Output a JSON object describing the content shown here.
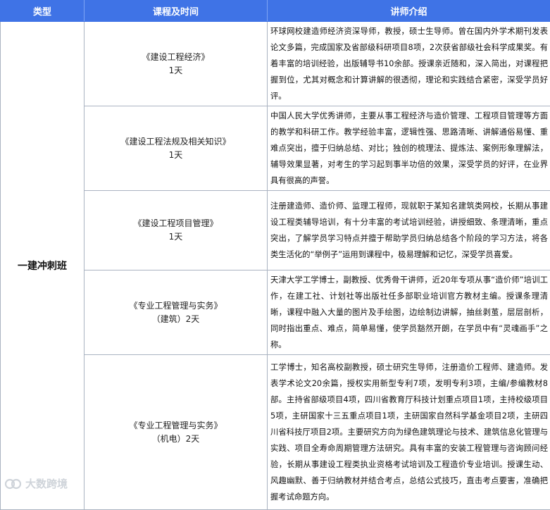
{
  "header": {
    "col_type": "类型",
    "col_course": "课程及时间",
    "col_teacher": "讲师介绍"
  },
  "type_label": "一建冲刺班",
  "rows": [
    {
      "course_lines": [
        "《建设工程经济》",
        "1天"
      ],
      "teacher": "环球网校建造师经济资深导师，教授，硕士生导师。曾在国内外学术期刊发表论文多篇，完成国家及省部级科研项目8项，2次获省部级社会科学成果奖。有着丰富的培训经验，出版辅导书10余部。授课亲近随和，深入简出，对课程把握到位，尤其对概念和计算讲解的很透彻，理论和实践结合紧密，深受学员好评。"
    },
    {
      "course_lines": [
        "《建设工程法规及相关知识》",
        "1天"
      ],
      "teacher": "中国人民大学优秀讲师，主要从事工程经济与造价管理、工程项目管理等方面的教学和科研工作。教学经验丰富，逻辑性强、思路清晰、讲解通俗易懂、重难点突出，擅于归纳总结、对比；独创的梳理法、提炼法、案例形象理解法，辅导效果显著，对考生的学习起到事半功倍的效果，深受学员的好评，在业界具有很高的声誉。"
    },
    {
      "course_lines": [
        "《建设工程项目管理》",
        "1天"
      ],
      "teacher": "注册建造师、造价师、监理工程师，现就职于某知名建筑类网校，长期从事建设工程类辅导培训，有十分丰富的考试培训经验，讲授细致、条理清晰，重点突出，了解学员学习特点并擅于帮助学员归纳总结各个阶段的学习方法，将各类生活化的“举例子”运用到课程中，极易理解和记忆，深受学员喜爱。"
    },
    {
      "course_lines": [
        "《专业工程管理与实务》",
        "（建筑）2天"
      ],
      "teacher": "天津大学工学博士，副教授、优秀骨干讲师，近20年专项从事“造价师”培训工作，在建工社、计划社等出版社任多部职业培训官方教材主编。授课条理清晰，课程中融入大量的图片及手绘图，边绘制边讲解，抽丝剥茧，层层剖析，同时指出重点、难点，简单易懂，使学员豁然开朗，在学员中有“灵魂画手”之称。"
    },
    {
      "course_lines": [
        "《专业工程管理与实务》",
        "（机电）2天"
      ],
      "teacher": "工学博士，知名高校副教授，硕士研究生导师，注册造价工程师、建造师。发表学术论文20余篇，授权实用新型专利7项，发明专利3项，主编/参编教材8部。主持省部级项目4项，四川省教育厅科技计划重点项目1项，主持校级项目5项，主研国家十三五重点项目1项，主研国家自然科学基金项目2项，主研四川省科技厅项目2项。主要研究方向为绿色建筑理论与技术、建筑信息化管理与实践、项目全寿命周期管理方法研究。具有丰富的安装工程管理与咨询顾问经验，长期从事建设工程类执业资格考试培训及工程造价专业培训。授课生动、风趣幽默、善于归纳教材并结合考点，总结公式技巧，直击考点要害，准确把握考试命题方向。"
    }
  ],
  "watermark": {
    "icon": "logo-icon",
    "text": "大数跨境"
  },
  "colors": {
    "header_bg": "#3f73e6",
    "header_text": "#ffffff",
    "border": "#aab3c1"
  }
}
